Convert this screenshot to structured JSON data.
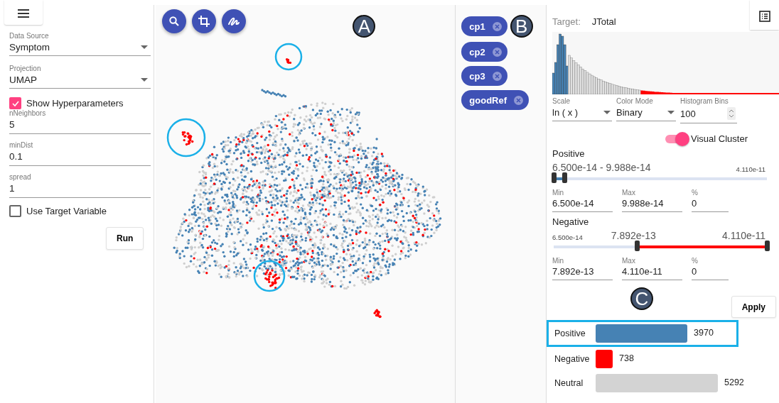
{
  "left_panel": {
    "data_source": {
      "label": "Data Source",
      "value": "Symptom"
    },
    "projection": {
      "label": "Projection",
      "value": "UMAP"
    },
    "show_hyperparameters": {
      "label": "Show Hyperparameters",
      "checked": true
    },
    "hyperparameters": [
      {
        "label": "nNeighbors",
        "value": "5"
      },
      {
        "label": "minDist",
        "value": "0.1"
      },
      {
        "label": "spread",
        "value": "1"
      }
    ],
    "use_target_variable": {
      "label": "Use Target Variable",
      "checked": false
    },
    "run_button": "Run"
  },
  "map_annotation": "A",
  "chips": [
    {
      "label": "cp1"
    },
    {
      "label": "cp2"
    },
    {
      "label": "cp3"
    },
    {
      "label": "goodRef"
    }
  ],
  "chips_annotation": "B",
  "right_panel": {
    "target_label": "Target:",
    "target_value": "JTotal",
    "scale": {
      "label": "Scale",
      "value": "ln ( x )"
    },
    "color_mode": {
      "label": "Color Mode",
      "value": "Binary"
    },
    "histogram_bins": {
      "label": "Histogram Bins",
      "value": "100"
    },
    "visual_cluster": {
      "label": "Visual Cluster",
      "on": true
    },
    "positive": {
      "title": "Positive",
      "range_text": "6.500e-14 - 9.988e-14",
      "max_label": "4.110e-11",
      "thumbs": [
        {
          "level": 0
        },
        {
          "level": 0.05
        }
      ],
      "fields": [
        {
          "label": "Min",
          "value": "6.500e-14"
        },
        {
          "label": "Max",
          "value": "9.988e-14"
        },
        {
          "label": "%",
          "value": "0"
        }
      ]
    },
    "negative": {
      "title": "Negative",
      "min_label": "6.500e-14",
      "low_text": "7.892e-13",
      "high_text": "4.110e-11",
      "thumbs": [
        {
          "level": 0.39
        },
        {
          "level": 1
        }
      ],
      "fields": [
        {
          "label": "Min",
          "value": "7.892e-13"
        },
        {
          "label": "Max",
          "value": "4.110e-11"
        },
        {
          "label": "%",
          "value": "0"
        }
      ]
    },
    "legend_annotation": "C",
    "apply_button": "Apply",
    "legend": [
      {
        "label": "Positive",
        "count": "3970",
        "color": "#4682b4",
        "highlighted": true
      },
      {
        "label": "Negative",
        "count": "738",
        "color": "#ff0000",
        "highlighted": false
      },
      {
        "label": "Neutral",
        "count": "5292",
        "color": "#d3d3d3",
        "highlighted": false
      }
    ]
  }
}
